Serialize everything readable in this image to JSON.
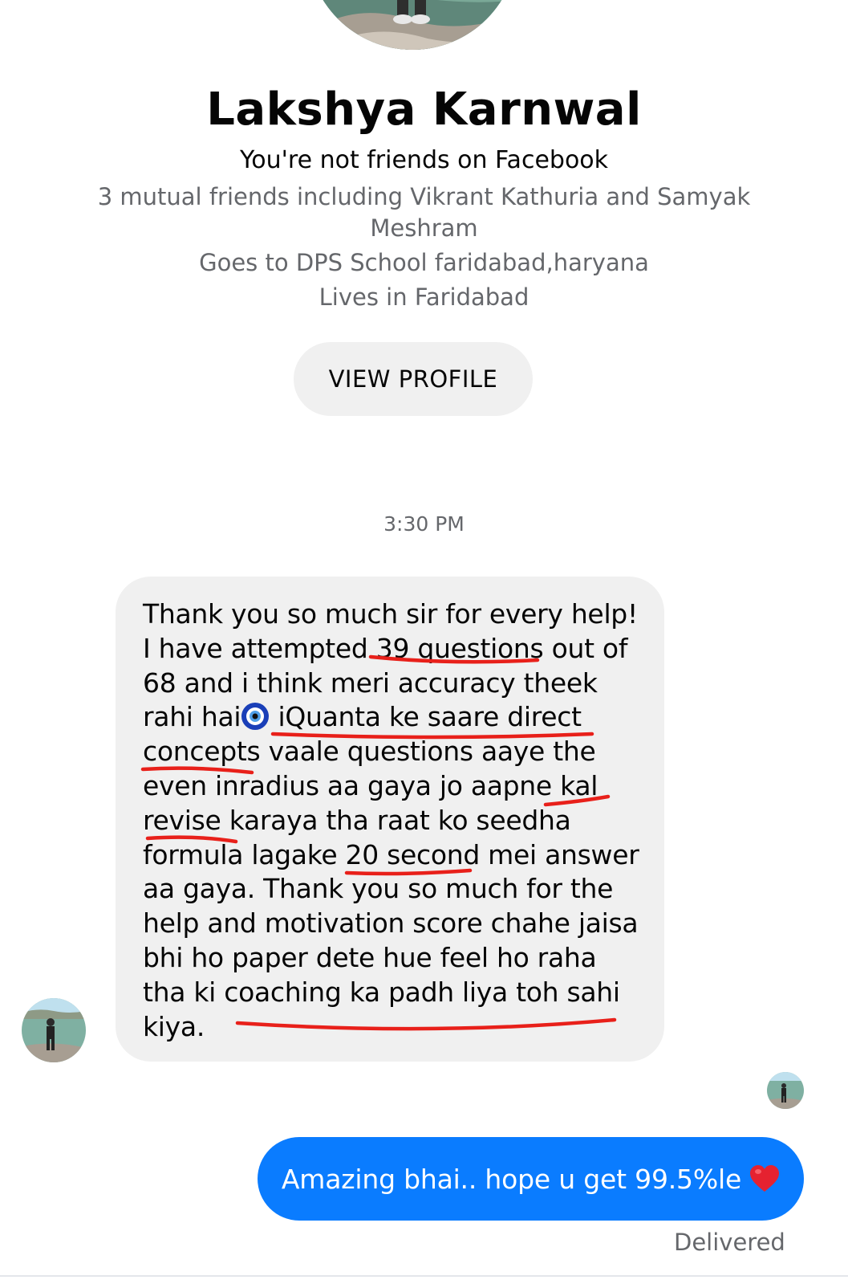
{
  "profile": {
    "name": "Lakshya Karnwal",
    "friend_status": "You're not friends on Facebook",
    "mutual_friends": "3 mutual friends including Vikrant Kathuria and Samyak Meshram",
    "school": "Goes to DPS School faridabad,haryana",
    "lives": "Lives in Faridabad",
    "view_profile_label": "VIEW PROFILE"
  },
  "conversation": {
    "timestamp": "3:30 PM",
    "received_message": {
      "before_emoji": "Thank you so much sir for every help!\nI have attempted 39 questions out of\n68 and i think meri accuracy theek\nrahi hai",
      "emoji_icon": "nazar-amulet-icon",
      "after_emoji": " iQuanta ke saare direct\nconcepts vaale questions aaye the\neven inradius aa gaya jo aapne kal\nrevise karaya tha raat ko seedha\nformula lagake 20 second mei answer\naa gaya. Thank you so much for the\nhelp and motivation score chahe jaisa\nbhi ho paper dete hue feel ho raha\ntha ki coaching ka padh liya toh sahi\nkiya."
    },
    "sent_message": {
      "text": "Amazing bhai.. hope u get 99.5%le",
      "emoji_icon": "red-heart-icon"
    },
    "delivery_status": "Delivered"
  },
  "colors": {
    "sent_bubble": "#0a7cff",
    "received_bubble": "#f0f0f0",
    "secondary_text": "#65676b",
    "underline_annotation": "#e8201a"
  }
}
